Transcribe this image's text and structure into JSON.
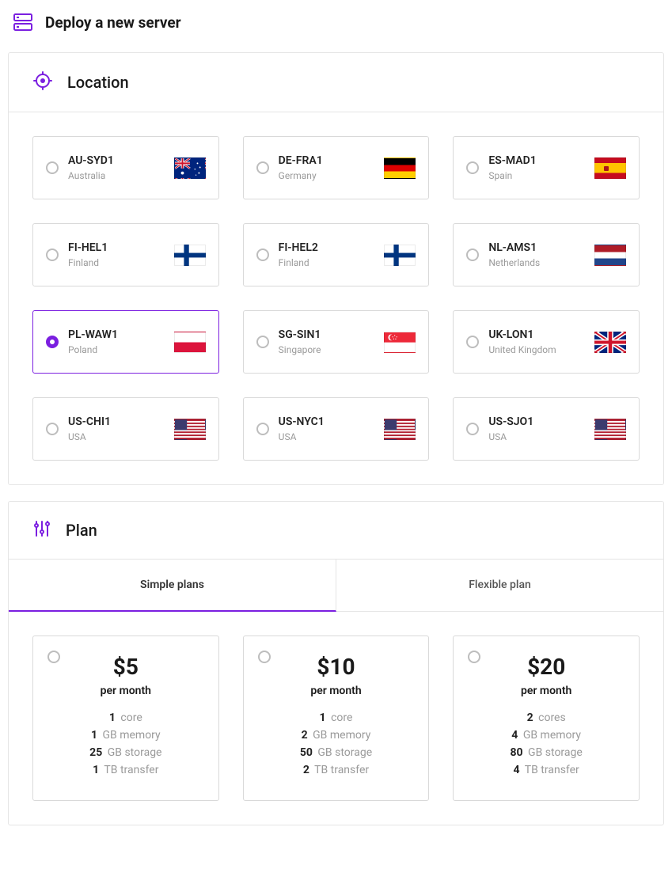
{
  "page": {
    "title": "Deploy a new server"
  },
  "location": {
    "heading": "Location",
    "items": [
      {
        "code": "AU-SYD1",
        "country": "Australia",
        "flag": "au",
        "selected": false
      },
      {
        "code": "DE-FRA1",
        "country": "Germany",
        "flag": "de",
        "selected": false
      },
      {
        "code": "ES-MAD1",
        "country": "Spain",
        "flag": "es",
        "selected": false
      },
      {
        "code": "FI-HEL1",
        "country": "Finland",
        "flag": "fi",
        "selected": false
      },
      {
        "code": "FI-HEL2",
        "country": "Finland",
        "flag": "fi",
        "selected": false
      },
      {
        "code": "NL-AMS1",
        "country": "Netherlands",
        "flag": "nl",
        "selected": false
      },
      {
        "code": "PL-WAW1",
        "country": "Poland",
        "flag": "pl",
        "selected": true
      },
      {
        "code": "SG-SIN1",
        "country": "Singapore",
        "flag": "sg",
        "selected": false
      },
      {
        "code": "UK-LON1",
        "country": "United Kingdom",
        "flag": "gb",
        "selected": false
      },
      {
        "code": "US-CHI1",
        "country": "USA",
        "flag": "us",
        "selected": false
      },
      {
        "code": "US-NYC1",
        "country": "USA",
        "flag": "us",
        "selected": false
      },
      {
        "code": "US-SJO1",
        "country": "USA",
        "flag": "us",
        "selected": false
      }
    ]
  },
  "plan": {
    "heading": "Plan",
    "tabs": [
      {
        "label": "Simple plans",
        "active": true
      },
      {
        "label": "Flexible plan",
        "active": false
      }
    ],
    "simple": [
      {
        "price": "$5",
        "period": "per month",
        "selected": false,
        "cores_n": "1",
        "cores_u": "core",
        "mem_n": "1",
        "mem_u": "GB memory",
        "stor_n": "25",
        "stor_u": "GB storage",
        "xfer_n": "1",
        "xfer_u": "TB transfer"
      },
      {
        "price": "$10",
        "period": "per month",
        "selected": false,
        "cores_n": "1",
        "cores_u": "core",
        "mem_n": "2",
        "mem_u": "GB memory",
        "stor_n": "50",
        "stor_u": "GB storage",
        "xfer_n": "2",
        "xfer_u": "TB transfer"
      },
      {
        "price": "$20",
        "period": "per month",
        "selected": false,
        "cores_n": "2",
        "cores_u": "cores",
        "mem_n": "4",
        "mem_u": "GB memory",
        "stor_n": "80",
        "stor_u": "GB storage",
        "xfer_n": "4",
        "xfer_u": "TB transfer"
      }
    ]
  }
}
